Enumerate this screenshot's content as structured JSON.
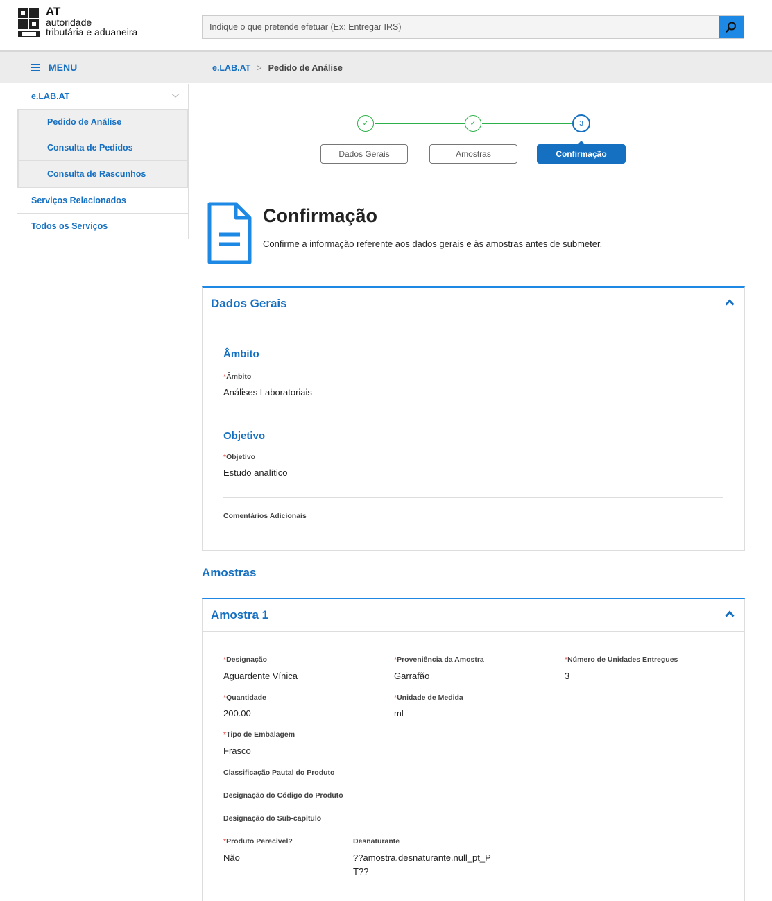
{
  "brand": {
    "short": "AT",
    "line1": "autoridade",
    "line2": "tributária e aduaneira"
  },
  "search": {
    "placeholder": "Indique o que pretende efetuar (Ex: Entregar IRS)"
  },
  "menu": {
    "label": "MENU"
  },
  "breadcrumb": {
    "root": "e.LAB.AT",
    "sep": ">",
    "current": "Pedido de Análise"
  },
  "sidebar": {
    "group": "e.LAB.AT",
    "subitems": [
      "Pedido de Análise",
      "Consulta de Pedidos",
      "Consulta de Rascunhos"
    ],
    "items": [
      "Serviços Relacionados",
      "Todos os Serviços"
    ]
  },
  "stepper": {
    "steps": [
      "Dados Gerais",
      "Amostras",
      "Confirmação"
    ],
    "current_number": "3",
    "done_mark": "✓"
  },
  "heading": {
    "title": "Confirmação",
    "description": "Confirme a informação referente aos dados gerais e às amostras antes de submeter."
  },
  "dados_gerais": {
    "title": "Dados Gerais",
    "ambito_section": "Âmbito",
    "ambito_label": "Âmbito",
    "ambito_value": "Análises Laboratoriais",
    "objetivo_section": "Objetivo",
    "objetivo_label": "Objetivo",
    "objetivo_value": "Estudo analítico",
    "comentarios_label": "Comentários Adicionais"
  },
  "amostras": {
    "section_title": "Amostras",
    "sample_title": "Amostra 1",
    "designacao_label": "Designação",
    "designacao_value": "Aguardente Vínica",
    "proveniencia_label": "Proveniência da Amostra",
    "proveniencia_value": "Garrafão",
    "unidades_label": "Número de Unidades Entregues",
    "unidades_value": "3",
    "quantidade_label": "Quantidade",
    "quantidade_value": "200.00",
    "unidade_medida_label": "Unidade de Medida",
    "unidade_medida_value": "ml",
    "embalagem_label": "Tipo de Embalagem",
    "embalagem_value": "Frasco",
    "classificacao_label": "Classificação Pautal do Produto",
    "codigo_label": "Designação do Código do Produto",
    "subcapitulo_label": "Designação do Sub-capitulo",
    "perecivel_label": "Produto Perecivel?",
    "perecivel_value": "Não",
    "desnaturante_label": "Desnaturante",
    "desnaturante_value_1": "??amostra.desnaturante.null_pt_P",
    "desnaturante_value_2": "T??"
  },
  "required_mark": "*",
  "colors": {
    "primary": "#1670c2",
    "accent": "#1e88e5",
    "success": "#2db14a",
    "required": "#e53935"
  }
}
